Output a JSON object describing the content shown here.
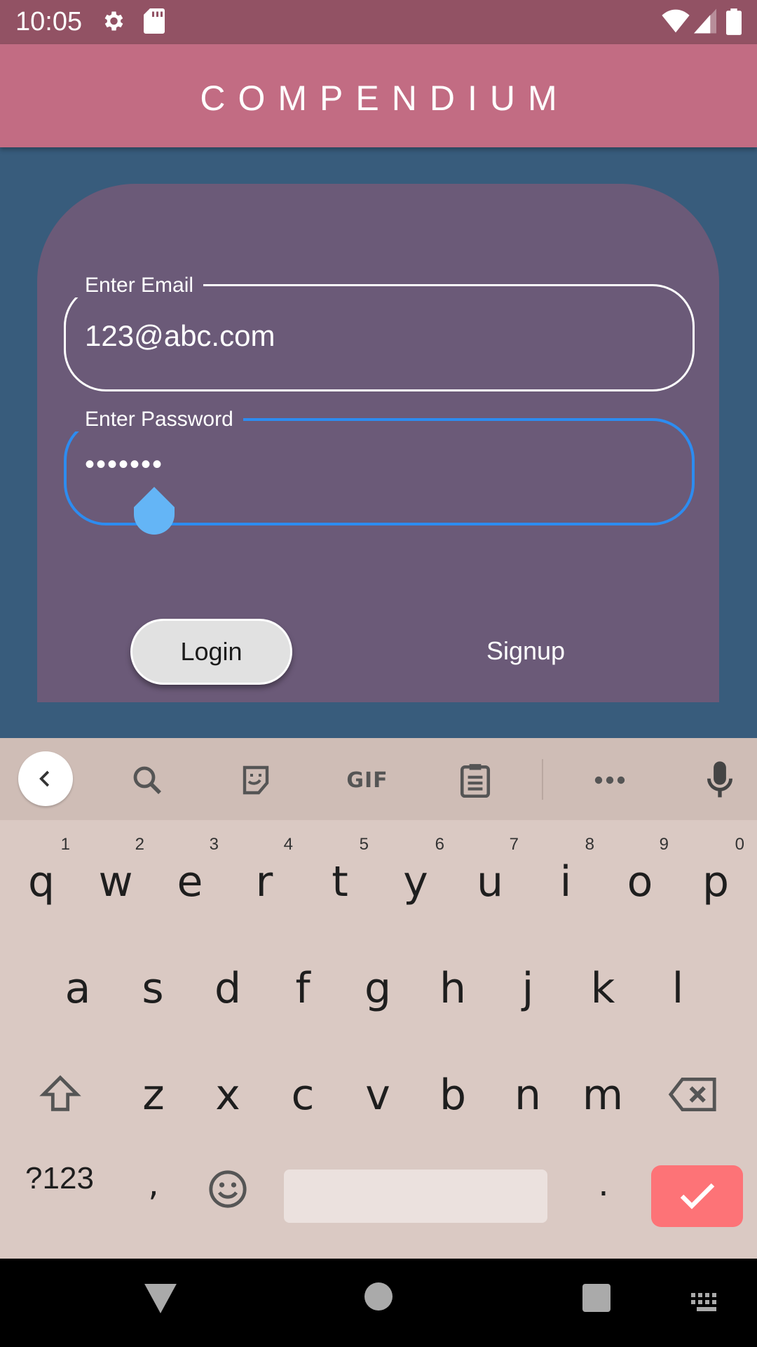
{
  "status_bar": {
    "time": "10:05",
    "icons": [
      "settings-icon",
      "sd-card-icon",
      "wifi-icon",
      "signal-icon",
      "battery-icon"
    ]
  },
  "app_bar": {
    "title": "COMPENDIUM"
  },
  "form": {
    "email_label": "Enter Email",
    "email_value": "123@abc.com",
    "password_label": "Enter Password",
    "password_value": "•••••••",
    "login_label": "Login",
    "signup_label": "Signup"
  },
  "keyboard": {
    "toolbar": [
      "back-icon",
      "search-icon",
      "sticker-icon",
      "gif-icon",
      "clipboard-icon",
      "more-icon",
      "mic-icon"
    ],
    "row1": [
      {
        "ch": "q",
        "num": "1"
      },
      {
        "ch": "w",
        "num": "2"
      },
      {
        "ch": "e",
        "num": "3"
      },
      {
        "ch": "r",
        "num": "4"
      },
      {
        "ch": "t",
        "num": "5"
      },
      {
        "ch": "y",
        "num": "6"
      },
      {
        "ch": "u",
        "num": "7"
      },
      {
        "ch": "i",
        "num": "8"
      },
      {
        "ch": "o",
        "num": "9"
      },
      {
        "ch": "p",
        "num": "0"
      }
    ],
    "row2": [
      "a",
      "s",
      "d",
      "f",
      "g",
      "h",
      "j",
      "k",
      "l"
    ],
    "row3": [
      "z",
      "x",
      "c",
      "v",
      "b",
      "n",
      "m"
    ],
    "symbols_label": "?123",
    "comma": ",",
    "period": ".",
    "gif_text": "GIF"
  },
  "colors": {
    "background": "#385c7c",
    "app_bar": "#c26c83",
    "status_bar": "#925264",
    "card": "#6b5a78",
    "focus": "#2d8cf0",
    "enter_key": "#fd7377"
  }
}
